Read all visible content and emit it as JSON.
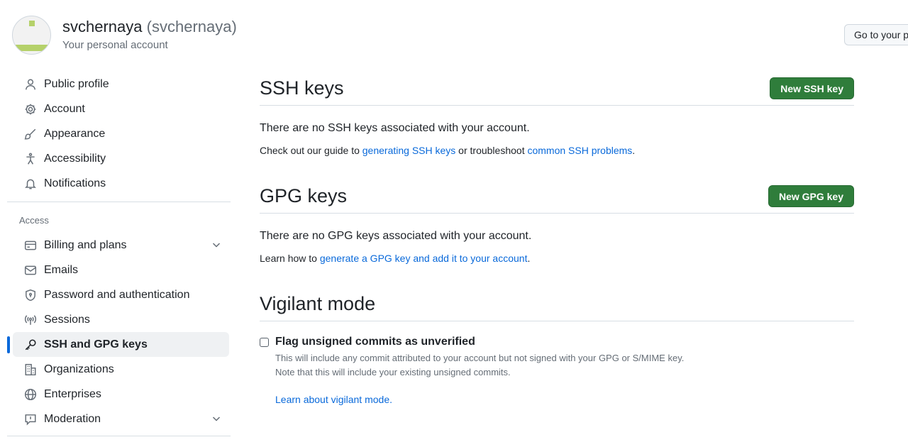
{
  "header": {
    "display_name": "svchernaya",
    "login": "(svchernaya)",
    "subtitle": "Your personal account",
    "goto_button": "Go to your personal profile"
  },
  "sidebar": {
    "items_top": [
      {
        "label": "Public profile",
        "icon": "person-icon"
      },
      {
        "label": "Account",
        "icon": "gear-icon"
      },
      {
        "label": "Appearance",
        "icon": "paintbrush-icon"
      },
      {
        "label": "Accessibility",
        "icon": "accessibility-icon"
      },
      {
        "label": "Notifications",
        "icon": "bell-icon"
      }
    ],
    "access_label": "Access",
    "items_access": [
      {
        "label": "Billing and plans",
        "icon": "credit-card-icon",
        "expandable": true
      },
      {
        "label": "Emails",
        "icon": "mail-icon"
      },
      {
        "label": "Password and authentication",
        "icon": "shield-lock-icon"
      },
      {
        "label": "Sessions",
        "icon": "broadcast-icon"
      },
      {
        "label": "SSH and GPG keys",
        "icon": "key-icon",
        "active": true
      },
      {
        "label": "Organizations",
        "icon": "organization-icon"
      },
      {
        "label": "Enterprises",
        "icon": "globe-icon"
      },
      {
        "label": "Moderation",
        "icon": "report-icon",
        "expandable": true
      }
    ]
  },
  "ssh": {
    "title": "SSH keys",
    "button": "New SSH key",
    "empty": "There are no SSH keys associated with your account.",
    "note_prefix": "Check out our guide to ",
    "note_link1": "generating SSH keys",
    "note_mid": " or troubleshoot ",
    "note_link2": "common SSH problems",
    "note_suffix": "."
  },
  "gpg": {
    "title": "GPG keys",
    "button": "New GPG key",
    "empty": "There are no GPG keys associated with your account.",
    "note_prefix": "Learn how to ",
    "note_link": "generate a GPG key and add it to your account",
    "note_suffix": "."
  },
  "vigilant": {
    "title": "Vigilant mode",
    "checkbox_label": "Flag unsigned commits as unverified",
    "checked": false,
    "desc_line1": "This will include any commit attributed to your account but not signed with your GPG or S/MIME key.",
    "desc_line2": "Note that this will include your existing unsigned commits.",
    "link": "Learn about vigilant mode."
  },
  "colors": {
    "accent": "#0969da",
    "button_green": "#2f7d3b",
    "avatar_green": "#b5d16a"
  }
}
